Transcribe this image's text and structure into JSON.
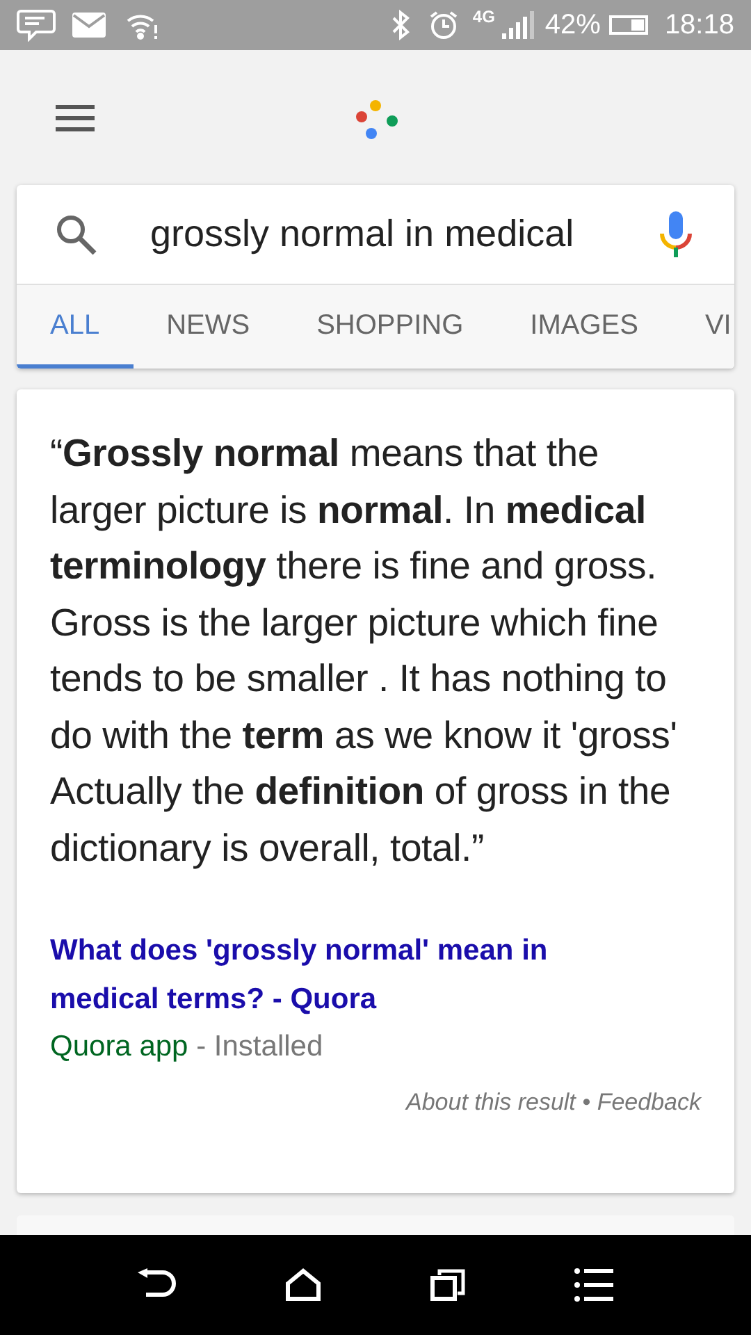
{
  "status_bar": {
    "network": "4G",
    "battery": "42%",
    "time": "18:18"
  },
  "search": {
    "value": "grossly normal in medical"
  },
  "tabs": [
    {
      "label": "ALL",
      "selected": true
    },
    {
      "label": "NEWS",
      "selected": false
    },
    {
      "label": "SHOPPING",
      "selected": false
    },
    {
      "label": "IMAGES",
      "selected": false
    },
    {
      "label": "VI",
      "selected": false
    }
  ],
  "answer": {
    "quote": "“**Grossly normal** means that the larger picture is **normal**. In **medical terminology** there is fine and gross. Gross is the larger picture which fine tends to be smaller . It has nothing to do with the **term** as we know it 'gross' Actually the **definition** of gross in the dictionary is overall, total.”",
    "link": "What does 'grossly normal' mean in medical terms? - Quora",
    "source": "Quora app",
    "source_note": "- Installed",
    "about": "About this result",
    "separator": "•",
    "feedback": "Feedback"
  }
}
